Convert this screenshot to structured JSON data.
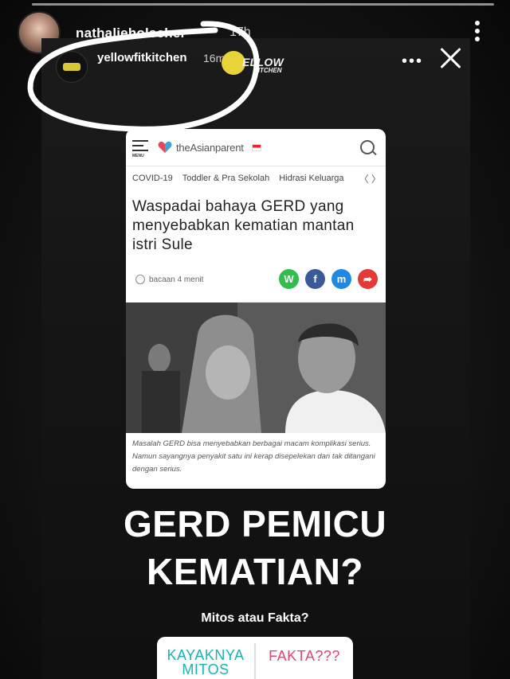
{
  "outer_story": {
    "username": "nathalieholscher",
    "time": "17h"
  },
  "inner_story": {
    "username": "yellowfitkitchen",
    "time": "16m",
    "sticker_text": "ELLOW",
    "sticker_subtext": "KITCHEN"
  },
  "article": {
    "menu_label": "MENU",
    "brand": "theAsianparent",
    "nav": [
      "COVID-19",
      "Toddler & Pra Sekolah",
      "Hidrasi Keluarga"
    ],
    "nav_more": "〈 〉",
    "headline": "Waspadai bahaya GERD yang menyebabkan kematian mantan istri Sule",
    "read_time": "bacaan 4 menit",
    "share_labels": [
      "W",
      "f",
      "m",
      "➦"
    ],
    "caption": "Masalah GERD bisa menyebabkan berbagai macam komplikasi serius. Namun sayangnya penyakit satu ini kerap disepelekan dan tak ditangani dengan serius."
  },
  "overlay": {
    "title_line1": "GERD PEMICU",
    "title_line2": "KEMATIAN?",
    "subtitle": "Mitos atau Fakta?"
  },
  "poll": {
    "option1": "KAYAKNYA MITOS",
    "option2": "FAKTA???"
  },
  "colors": {
    "poll_option1": "#19b3b3",
    "poll_option2": "#e7456d",
    "brand_heart": "#e8445a"
  }
}
